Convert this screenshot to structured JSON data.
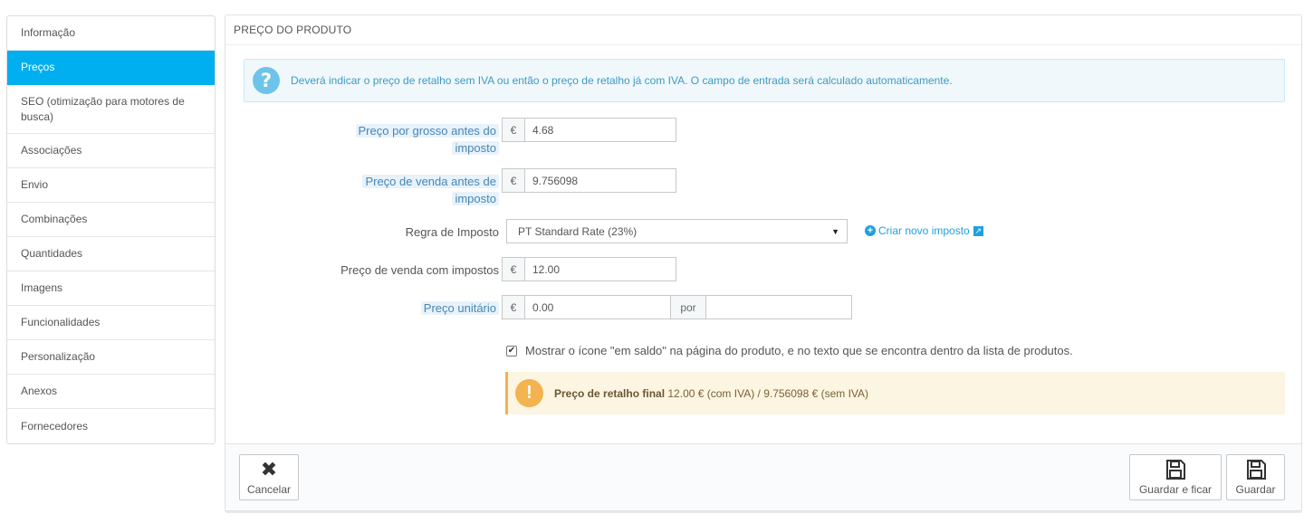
{
  "sidebar": {
    "items": [
      {
        "label": "Informação"
      },
      {
        "label": "Preços"
      },
      {
        "label": "SEO (otimização para motores de busca)"
      },
      {
        "label": "Associações"
      },
      {
        "label": "Envio"
      },
      {
        "label": "Combinações"
      },
      {
        "label": "Quantidades"
      },
      {
        "label": "Imagens"
      },
      {
        "label": "Funcionalidades"
      },
      {
        "label": "Personalização"
      },
      {
        "label": "Anexos"
      },
      {
        "label": "Fornecedores"
      }
    ],
    "active": "Preços"
  },
  "panel": {
    "title": "PREÇO DO PRODUTO",
    "info_text": "Deverá indicar o preço de retalho sem IVA ou então o preço de retalho já com IVA. O campo de entrada será calculado automaticamente.",
    "fields": {
      "wholesale": {
        "label_line1": "Preço por grosso antes do",
        "label_line2": "imposto",
        "currency": "€",
        "value": "4.68"
      },
      "retail": {
        "label_line1": "Preço de venda antes de",
        "label_line2": "imposto",
        "currency": "€",
        "value": "9.756098"
      },
      "tax_rule": {
        "label": "Regra de Imposto",
        "selected": "PT Standard Rate (23%)",
        "link": "Criar novo imposto"
      },
      "retail_tax": {
        "label": "Preço de venda com impostos",
        "currency": "€",
        "value": "12.00"
      },
      "unit_price": {
        "label": "Preço unitário",
        "currency": "€",
        "value": "0.00",
        "per": "por",
        "unit_value": ""
      }
    },
    "on_sale_checkbox": {
      "checked": true,
      "label": "Mostrar o ícone \"em saldo\" na página do produto, e no texto que se encontra dentro da lista de produtos."
    },
    "final_price": {
      "label": "Preço de retalho final",
      "text": " 12.00 € (com IVA) / 9.756098 € (sem IVA)"
    }
  },
  "footer": {
    "cancel": "Cancelar",
    "save_stay": "Guardar e ficar",
    "save": "Guardar"
  },
  "colors": {
    "accent": "#00aff0",
    "info": "#3d9ac3",
    "warning": "#f3b34e"
  }
}
